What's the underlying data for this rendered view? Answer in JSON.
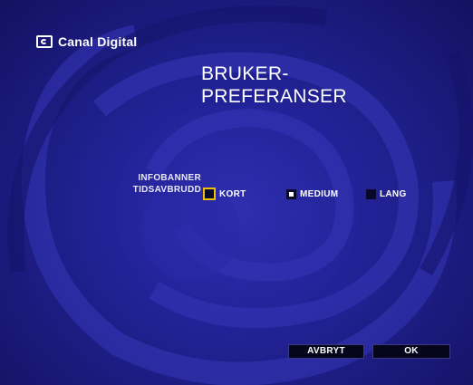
{
  "brand": {
    "name": "Canal Digital",
    "icon": "tv-logo-icon"
  },
  "title": {
    "line1": "BRUKER-",
    "line2": "PREFERANSER"
  },
  "setting": {
    "label_line1": "INFOBANNER",
    "label_line2": "TIDSAVBRUDD",
    "options": [
      {
        "label": "KORT",
        "focused": true,
        "checked": false
      },
      {
        "label": "MEDIUM",
        "focused": false,
        "checked": true
      },
      {
        "label": "LANG",
        "focused": false,
        "checked": false
      }
    ]
  },
  "buttons": {
    "cancel": "AVBRYT",
    "ok": "OK"
  },
  "colors": {
    "background": "#23239a",
    "focus": "#f0c000",
    "button_bg": "#05051c",
    "text": "#ffffff"
  }
}
